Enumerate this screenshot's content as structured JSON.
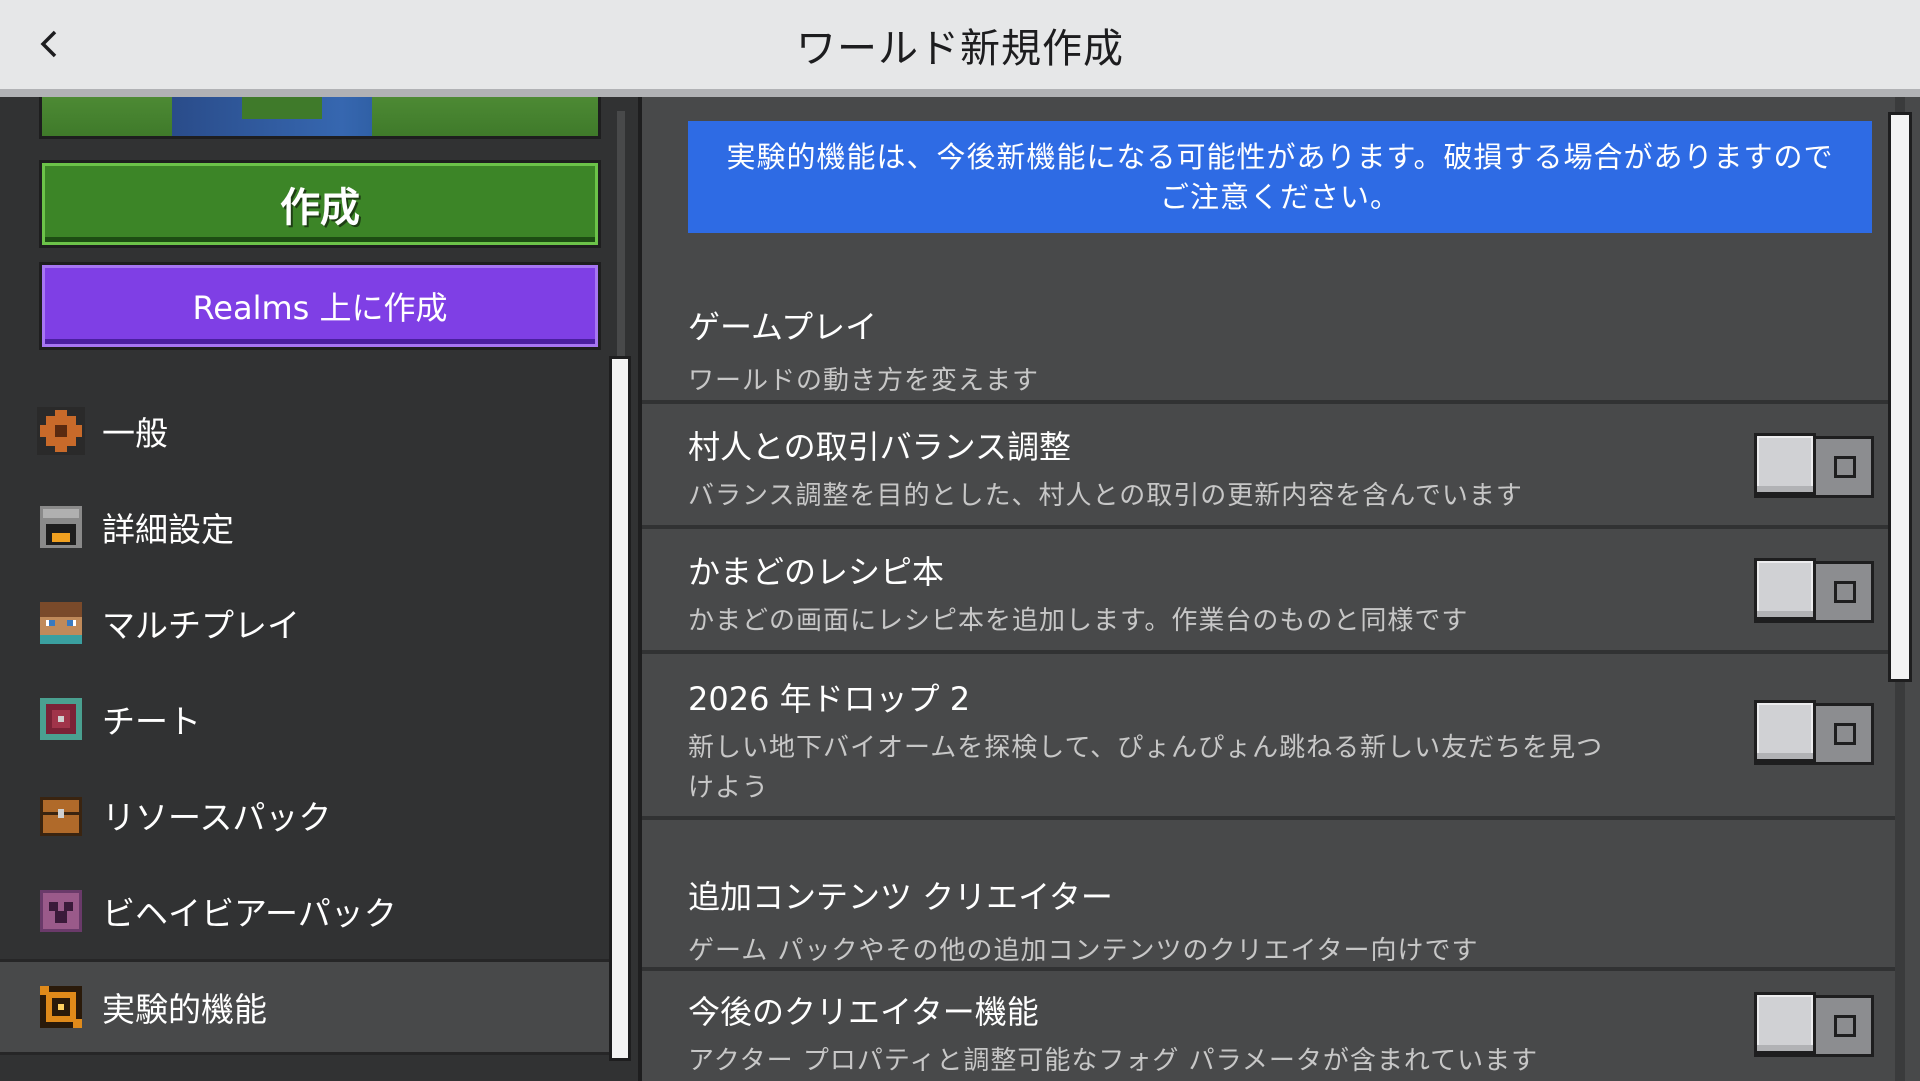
{
  "header": {
    "title": "ワールド新規作成"
  },
  "left": {
    "create_label": "作成",
    "realms_label": "Realms 上に作成",
    "nav": [
      {
        "id": "general",
        "label": "一般",
        "icon": "gear-icon",
        "color": "#c86a2a"
      },
      {
        "id": "advanced",
        "label": "詳細設定",
        "icon": "furnace-icon",
        "color": "#8a8a8a"
      },
      {
        "id": "multiplayer",
        "label": "マルチプレイ",
        "icon": "player-head-icon",
        "color": "#a0704a"
      },
      {
        "id": "cheats",
        "label": "チート",
        "icon": "command-block-icon",
        "color": "#7a2236"
      },
      {
        "id": "resource-packs",
        "label": "リソースパック",
        "icon": "chest-icon",
        "color": "#b06a2a"
      },
      {
        "id": "behavior-packs",
        "label": "ビヘイビアーパック",
        "icon": "creeper-icon",
        "color": "#8a4a7a"
      },
      {
        "id": "experiments",
        "label": "実験的機能",
        "icon": "experiments-icon",
        "color": "#e08a1a",
        "active": true
      }
    ]
  },
  "right": {
    "notice": "実験的機能は、今後新機能になる可能性があります。破損する場合がありますのでご注意ください。",
    "sections": [
      {
        "title": "ゲームプレイ",
        "desc": "ワールドの動き方を変えます"
      },
      {
        "title": "追加コンテンツ クリエイター",
        "desc": "ゲーム パックやその他の追加コンテンツのクリエイター向けです"
      }
    ],
    "settings": [
      {
        "title": "村人との取引バランス調整",
        "desc": "バランス調整を目的とした、村人との取引の更新内容を含んでいます",
        "enabled": false
      },
      {
        "title": "かまどのレシピ本",
        "desc": "かまどの画面にレシピ本を追加します。作業台のものと同様です",
        "enabled": false
      },
      {
        "title": "2026 年ドロップ 2",
        "desc": "新しい地下バイオームを探検して、ぴょんぴょん跳ねる新しい友だちを見つけよう",
        "enabled": false
      },
      {
        "title": "今後のクリエイター機能",
        "desc": "アクター プロパティと調整可能なフォグ パラメータが含まれています",
        "enabled": false
      }
    ]
  }
}
